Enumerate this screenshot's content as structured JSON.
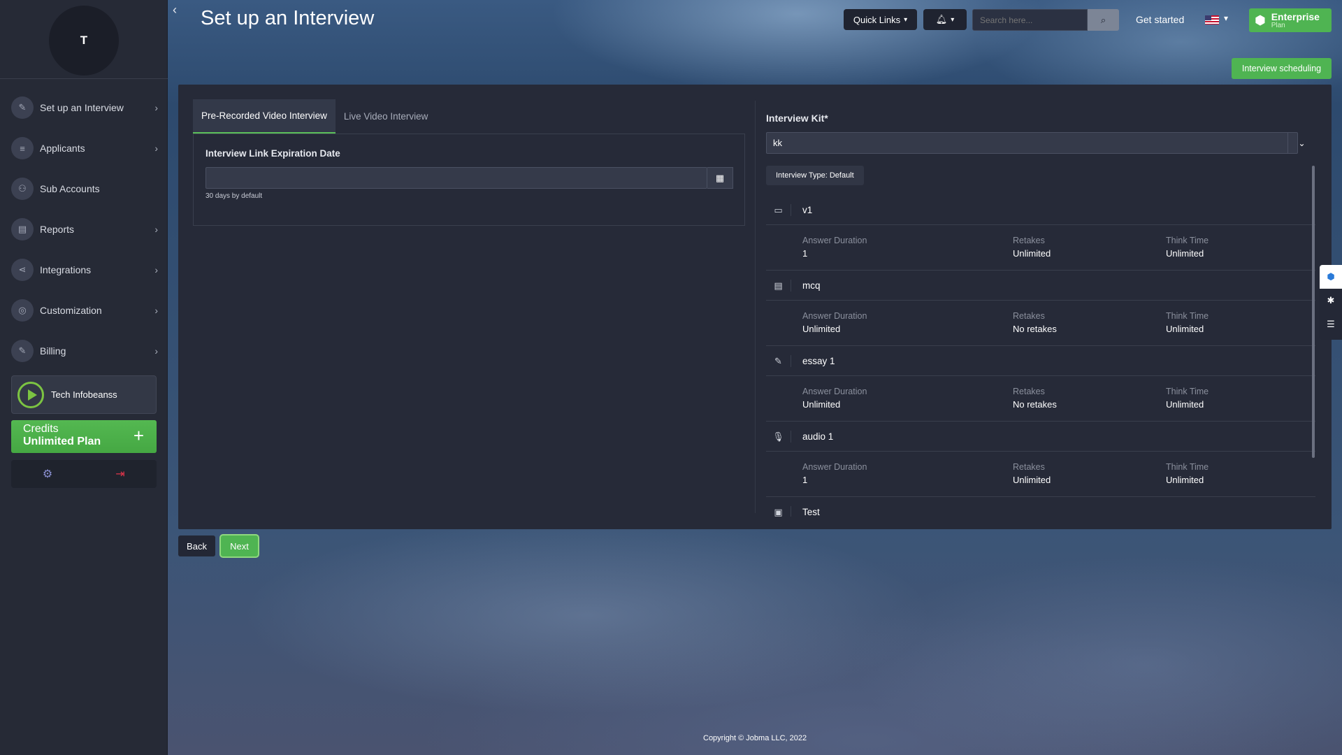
{
  "sidebar": {
    "avatar_initial": "T",
    "items": [
      {
        "label": "Set up an Interview",
        "icon": "edit-icon",
        "chevron": true
      },
      {
        "label": "Applicants",
        "icon": "list-icon",
        "chevron": true
      },
      {
        "label": "Sub Accounts",
        "icon": "user-plus-icon",
        "chevron": false
      },
      {
        "label": "Reports",
        "icon": "document-icon",
        "chevron": true
      },
      {
        "label": "Integrations",
        "icon": "share-icon",
        "chevron": true
      },
      {
        "label": "Customization",
        "icon": "palette-icon",
        "chevron": true
      },
      {
        "label": "Billing",
        "icon": "edit-icon",
        "chevron": true
      }
    ],
    "company_name": "Tech Infobeanss",
    "credits_line1": "Credits",
    "credits_line2": "Unlimited Plan"
  },
  "header": {
    "title": "Set up an Interview",
    "quick_links": "Quick Links",
    "search_placeholder": "Search here...",
    "get_started": "Get started",
    "plan_name": "Enterprise",
    "plan_sub": "Plan",
    "scheduling_button": "Interview scheduling"
  },
  "tabs": [
    {
      "label": "Pre-Recorded Video Interview",
      "active": true
    },
    {
      "label": "Live Video Interview",
      "active": false
    }
  ],
  "expiration": {
    "label": "Interview Link Expiration Date",
    "value": "",
    "helper": "30 days by default"
  },
  "kit": {
    "label": "Interview Kit*",
    "selected": "kk",
    "type_chip": "Interview Type: Default"
  },
  "question_meta_labels": {
    "duration": "Answer Duration",
    "retakes": "Retakes",
    "think": "Think Time"
  },
  "questions": [
    {
      "title": "v1",
      "icon": "video-camera-icon",
      "duration": "1",
      "retakes": "Unlimited",
      "think": "Unlimited"
    },
    {
      "title": "mcq",
      "icon": "document-icon",
      "duration": "Unlimited",
      "retakes": "No retakes",
      "think": "Unlimited"
    },
    {
      "title": "essay 1",
      "icon": "pencil-icon",
      "duration": "Unlimited",
      "retakes": "No retakes",
      "think": "Unlimited"
    },
    {
      "title": "audio 1",
      "icon": "microphone-icon",
      "duration": "1",
      "retakes": "Unlimited",
      "think": "Unlimited"
    },
    {
      "title": "Test",
      "icon": "film-icon"
    }
  ],
  "buttons": {
    "back": "Back",
    "next": "Next"
  },
  "footer": "Copyright © Jobma LLC, 2022",
  "colors": {
    "accent_green": "#4fb452",
    "sidebar_bg": "#262a36",
    "panel_bg": "#262a38"
  }
}
